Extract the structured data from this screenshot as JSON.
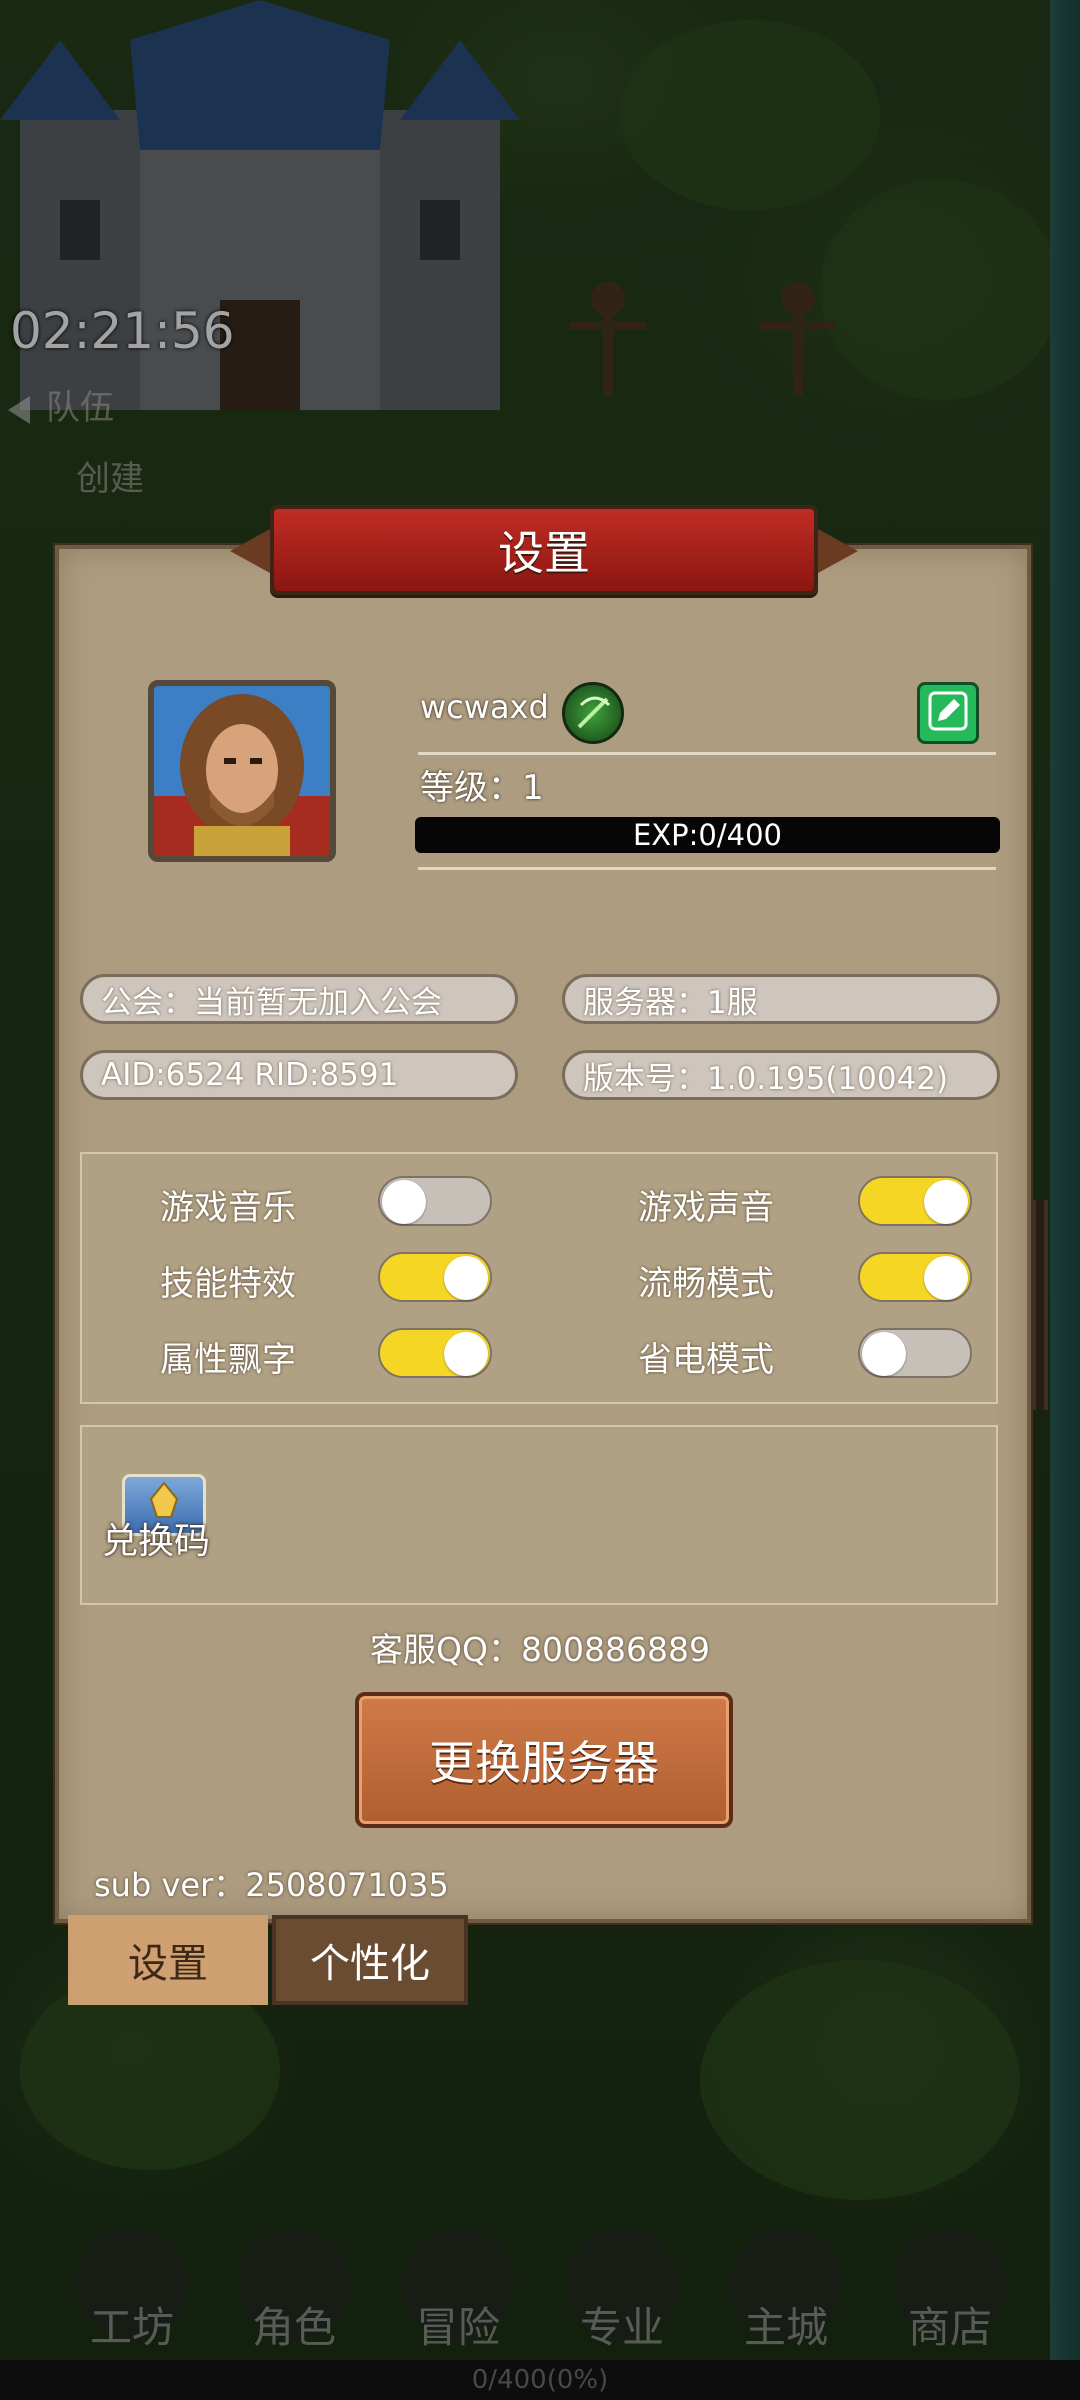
{
  "background": {
    "timer": "02:21:56",
    "team_menu": [
      "队伍",
      "创建"
    ]
  },
  "panel": {
    "title": "设置",
    "profile": {
      "avatar_icon": "warrior-portrait",
      "username": "wcwaxd",
      "class_icon": "crossbow-class-icon",
      "level_label": "等级：1",
      "exp_text": "EXP:0/400",
      "exp_progress": 0
    },
    "info": {
      "guild": "公会：当前暂无加入公会",
      "server": "服务器：1服",
      "ids": "AID:6524  RID:8591",
      "version": "版本号：1.0.195(10042)"
    },
    "toggles": [
      {
        "label": "游戏音乐",
        "on": false
      },
      {
        "label": "游戏声音",
        "on": true
      },
      {
        "label": "技能特效",
        "on": true
      },
      {
        "label": "流畅模式",
        "on": true
      },
      {
        "label": "属性飘字",
        "on": true
      },
      {
        "label": "省电模式",
        "on": false
      }
    ],
    "redeem_code_label": "兑换码",
    "support_qq": "客服QQ：800886889",
    "change_server_label": "更换服务器",
    "sub_version": "sub ver：2508071035"
  },
  "tabs": {
    "settings": "设置",
    "personalize": "个性化"
  },
  "bottom_nav": [
    "工坊",
    "角色",
    "冒险",
    "专业",
    "主城",
    "商店"
  ],
  "bottom_progress": "0/400(0%)",
  "colors": {
    "panel": "#ad9c80",
    "toggle_on": "#f6d625",
    "toggle_off": "#c7c0b8",
    "banner": "#c02d24",
    "edit_button": "#25b95b",
    "server_button": "#c76c3b"
  }
}
